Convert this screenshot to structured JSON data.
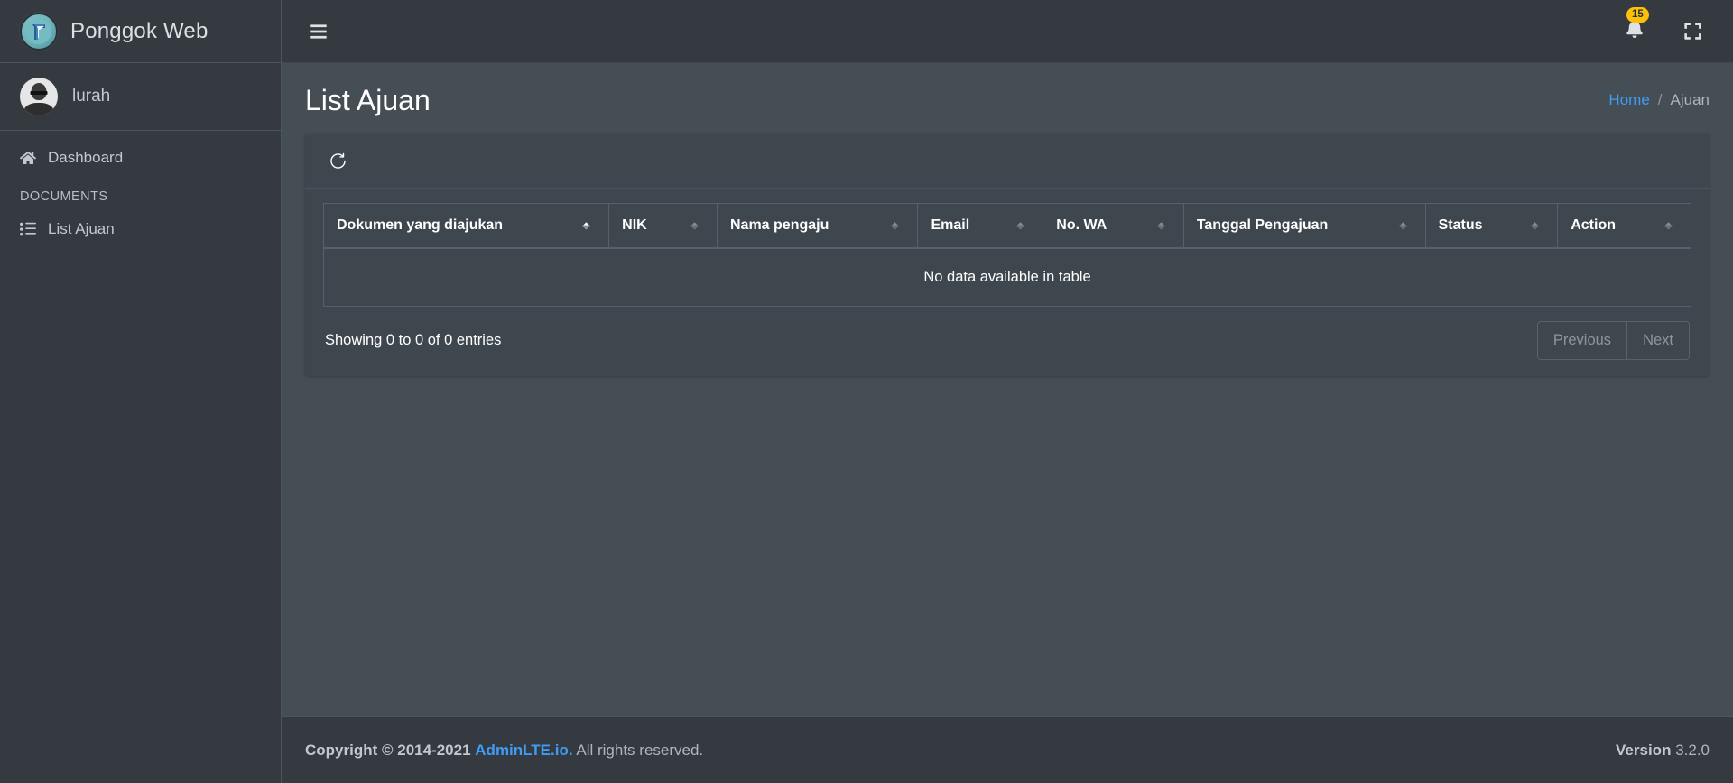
{
  "sidebar": {
    "brand": {
      "text": "Ponggok Web",
      "logo_icon": "ponggok-logo-icon"
    },
    "user": {
      "name": "lurah",
      "avatar_icon": "user-avatar"
    },
    "items": [
      {
        "label": "Dashboard",
        "icon": "home-icon",
        "type": "link"
      },
      {
        "label": "DOCUMENTS",
        "type": "header"
      },
      {
        "label": "List Ajuan",
        "icon": "list-ul-icon",
        "type": "link"
      }
    ]
  },
  "navbar": {
    "menu_icon": "hamburger-icon",
    "bell_icon": "bell-icon",
    "notification_count": "15",
    "fullscreen_icon": "expand-arrows-icon"
  },
  "header": {
    "title": "List Ajuan",
    "breadcrumb": {
      "home": "Home",
      "separator": "/",
      "current": "Ajuan"
    }
  },
  "card": {
    "refresh_icon": "refresh-icon"
  },
  "table": {
    "columns": [
      {
        "label": "Dokumen yang diajukan",
        "sorted": true
      },
      {
        "label": "NIK",
        "sorted": false
      },
      {
        "label": "Nama pengaju",
        "sorted": false
      },
      {
        "label": "Email",
        "sorted": false
      },
      {
        "label": "No. WA",
        "sorted": false
      },
      {
        "label": "Tanggal Pengajuan",
        "sorted": false
      },
      {
        "label": "Status",
        "sorted": false
      },
      {
        "label": "Action",
        "sorted": false
      }
    ],
    "empty_message": "No data available in table",
    "info": "Showing 0 to 0 of 0 entries",
    "pagination": {
      "previous": "Previous",
      "next": "Next"
    }
  },
  "footer": {
    "copyright_bold": "Copyright © 2014-2021",
    "link": "AdminLTE.io.",
    "rest": "All rights reserved.",
    "version_label": "Version",
    "version_value": "3.2.0"
  },
  "colors": {
    "sidebar_bg": "#343a40",
    "content_bg": "#454d55",
    "card_bg": "#3f474e",
    "accent_link": "#3f9cf4",
    "badge_bg": "#ffc107"
  }
}
